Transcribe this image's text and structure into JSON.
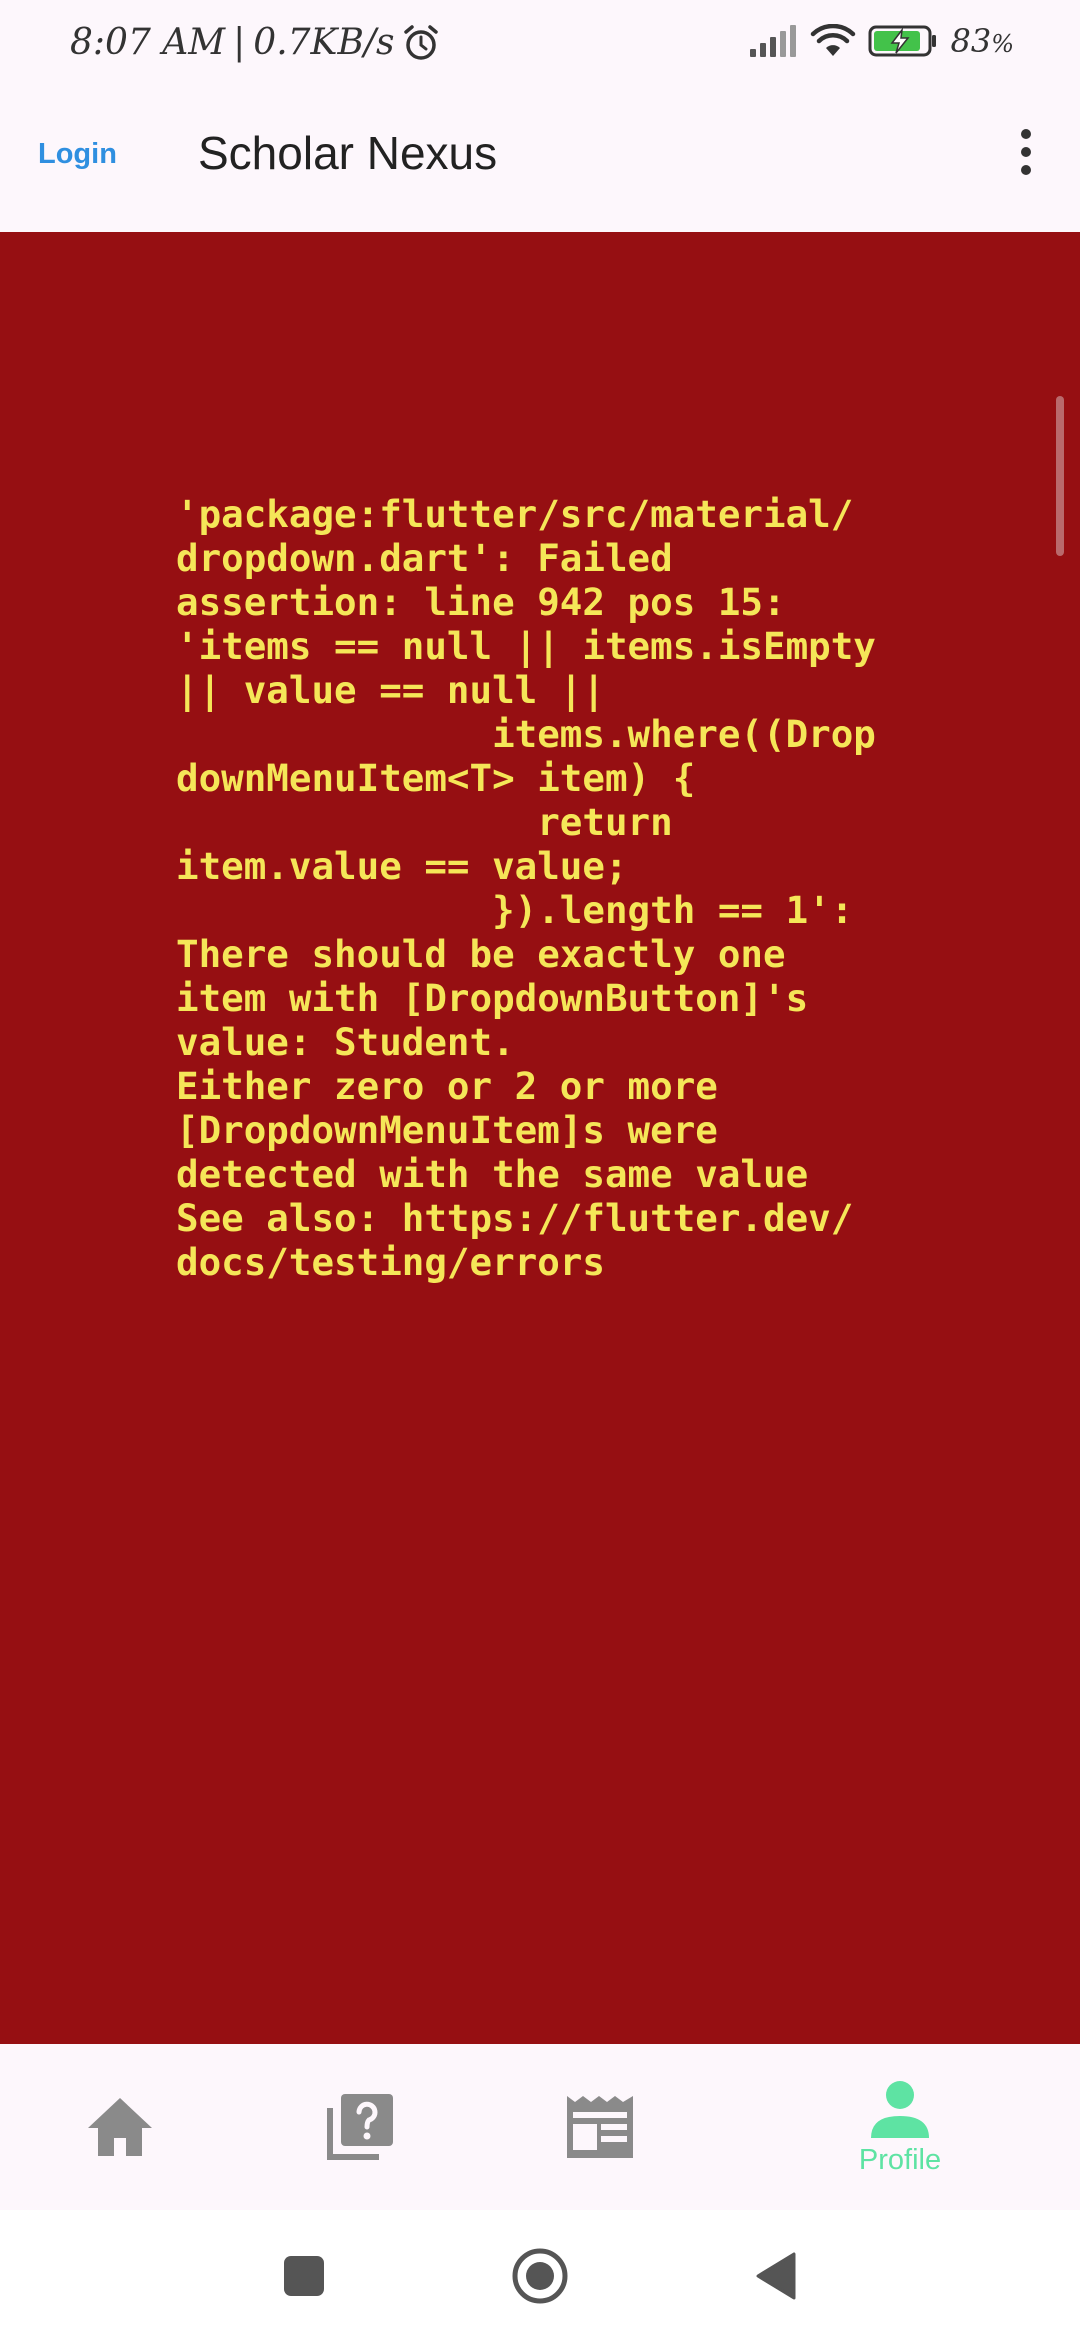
{
  "status_bar": {
    "time": "8:07 AM",
    "separator": "|",
    "network_speed": "0.7KB/s",
    "battery_percent": "83",
    "battery_unit": "%",
    "icons": [
      "alarm-icon",
      "signal-icon",
      "wifi-icon",
      "battery-charging-icon"
    ]
  },
  "app_bar": {
    "login_label": "Login",
    "title": "Scholar Nexus",
    "more_icon": "more-vert-icon"
  },
  "error": {
    "lines": [
      "'package:flutter/src/material/",
      "dropdown.dart': Failed",
      "assertion: line 942 pos 15:",
      "'items == null || items.isEmpty",
      "|| value == null ||",
      "              items.where((Drop",
      "downMenuItem<T> item) {",
      "                return",
      "item.value == value;",
      "              }).length == 1':",
      "There should be exactly one",
      "item with [DropdownButton]'s",
      "value: Student.",
      "Either zero or 2 or more",
      "[DropdownMenuItem]s were",
      "detected with the same value",
      "See also: https://flutter.dev/",
      "docs/testing/errors"
    ],
    "background_color": "#960f12",
    "text_color": "#f5e658"
  },
  "bottom_nav": {
    "items": [
      {
        "icon": "home-icon",
        "label": ""
      },
      {
        "icon": "quiz-icon",
        "label": ""
      },
      {
        "icon": "newspaper-icon",
        "label": ""
      },
      {
        "icon": "person-icon",
        "label": "Profile",
        "active": true
      }
    ],
    "active_color": "#5ee3a3",
    "inactive_color": "#8a8a8a"
  },
  "system_nav": {
    "icons": [
      "recents-square-icon",
      "home-circle-icon",
      "back-triangle-icon"
    ]
  }
}
